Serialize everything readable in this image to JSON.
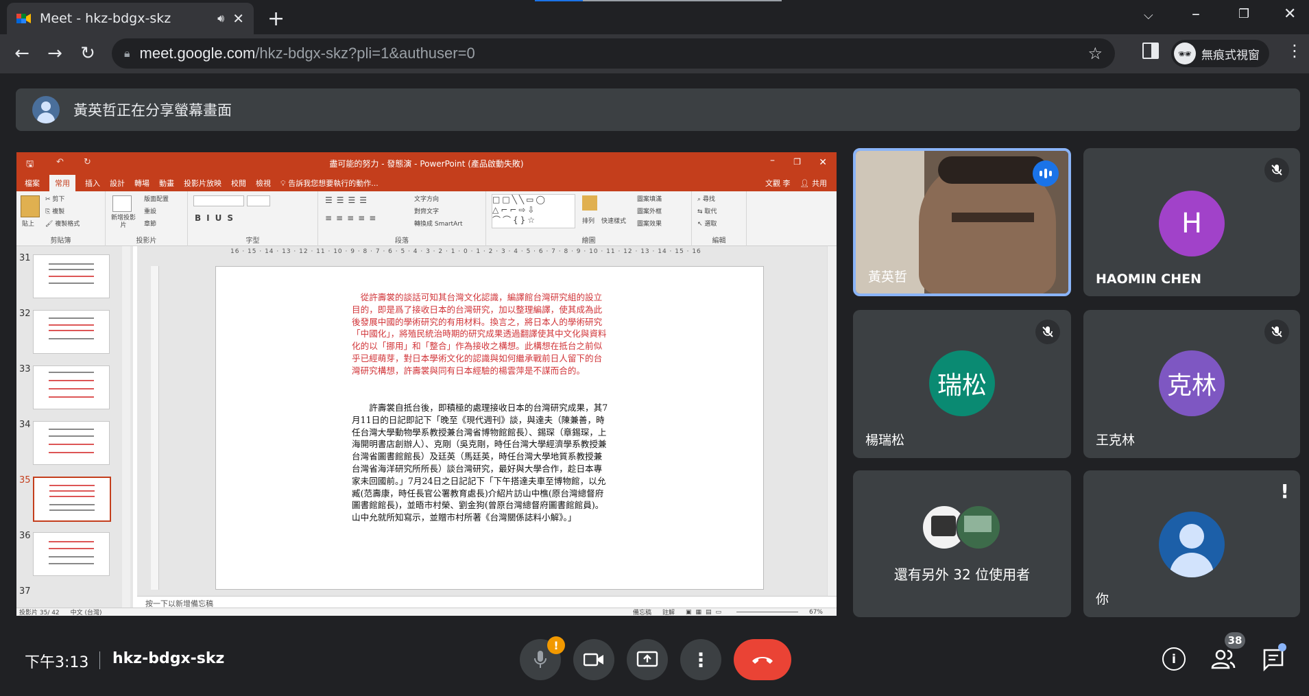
{
  "browser": {
    "tab_title": "Meet - hkz-bdgx-skz",
    "url_host": "meet.google.com",
    "url_path": "/hkz-bdgx-skz?pli=1&authuser=0",
    "profile_label": "無痕式視窗"
  },
  "banner": {
    "text": "黃英哲正在分享螢幕畫面"
  },
  "powerpoint": {
    "window_title": "盡可能的努力 - 發態演 - PowerPoint (產品啟動失敗)",
    "tabs": [
      "檔案",
      "常用",
      "插入",
      "設計",
      "轉場",
      "動畫",
      "投影片放映",
      "校閱",
      "檢視"
    ],
    "active_tab": "常用",
    "tell_me": "告訴我您想要執行的動作...",
    "user": "文觀 李",
    "share": "共用",
    "groups": {
      "clipboard": "剪貼簿",
      "slides": "投影片",
      "font": "字型",
      "paragraph": "段落",
      "drawing": "繪圖",
      "editing": "編輯"
    },
    "ribbon_buttons": {
      "paste": "貼上",
      "cut": "剪下",
      "copy": "複製",
      "format_painter": "複製格式",
      "new_slide": "新增投影片",
      "layout": "版面配置",
      "reset": "重設",
      "section": "章節",
      "text_direction": "文字方向",
      "align_text": "對齊文字",
      "smartart": "轉換成 SmartArt",
      "arrange": "排列",
      "quick_styles": "快速樣式",
      "shape_fill": "圖案填滿",
      "shape_outline": "圖案外框",
      "shape_effects": "圖案效果",
      "find": "尋找",
      "replace": "取代",
      "select": "選取"
    },
    "ruler": "16 · 15 · 14 · 13 · 12 · 11 · 10 · 9 · 8 · 7 · 6 · 5 · 4 · 3 · 2 · 1 · 0 · 1 · 2 · 3 · 4 · 5 · 6 · 7 · 8 · 9 · 10 · 11 · 12 · 13 · 14 · 15 · 16",
    "slide_numbers": [
      "31",
      "32",
      "33",
      "34",
      "35",
      "36",
      "37"
    ],
    "selected_slide": "35",
    "slide_text_red": "從許壽裳的談話可知其台灣文化認識，編譯館台灣研究組的設立目的，即是爲了接收日本的台灣研究，加以整理編譯，使其成為此後發展中國的學術研究的有用材料。換言之，將日本人的學術研究「中國化」，將殖民統治時期的研究成果透過翻譯使其中文化與資料化的以「挪用」和「整合」作為接收之構想。此構想在抵台之前似乎已經萌芽，對日本學術文化的認識與如何繼承戰前日人留下的台灣研究構想，許壽裳與同有日本經驗的楊雲萍是不謀而合的。",
    "slide_text_black": "許壽裳自抵台後，即積極的處理接收日本的台灣研究成果，其7月11日的日記即記下「晚至《現代週刊》談，與達夫（陳兼善，時任台灣大學動物學系教授兼台灣省博物館館長）、錫琛（章錫琛，上海開明書店創辦人）、克剛（吳克剛，時任台灣大學經濟學系教授兼台灣省圖書館館長）及廷英（馬廷英，時任台灣大學地質系教授兼台灣省海洋研究所所長）談台灣研究，最好與大學合作，趁日本專家未回國前。」7月24日之日記記下「下午搭達夫車至博物館，以允臧(范壽康，時任長官公署教育處長)介紹片訪山中樵(原台灣總督府圖書館館長)，並晤市村榮、劉金狗(曾原台灣總督府圖書館館員)。山中允就所知寫示，並贈市村所著《台灣關係誌料小解》。」",
    "notes_placeholder": "按一下以新增備忘稿",
    "status_slide": "投影片 35/ 42",
    "status_lang": "中文 (台灣)",
    "status_notes": "備忘稿",
    "status_comments": "註解",
    "zoom": "67%"
  },
  "participants": [
    {
      "name": "黃英哲",
      "type": "video",
      "speaking": true
    },
    {
      "name": "HAOMIN CHEN",
      "initials": "H",
      "avatar_color": "#a142c9",
      "muted": true
    },
    {
      "name": "楊瑞松",
      "initials": "瑞松",
      "avatar_color": "#0a8a72",
      "muted": true
    },
    {
      "name": "王克林",
      "initials": "克林",
      "avatar_color": "#7e57c2",
      "muted": true
    },
    {
      "name": "還有另外 32 位使用者",
      "type": "overflow"
    },
    {
      "name": "你",
      "type": "self"
    }
  ],
  "bottom_bar": {
    "time": "下午3:13",
    "meeting_code": "hkz-bdgx-skz",
    "participant_count": "38",
    "end_call_color": "#ea4335"
  }
}
